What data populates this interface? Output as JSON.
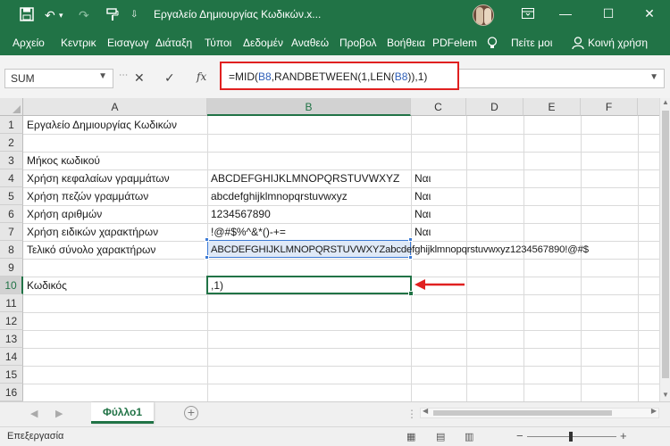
{
  "window": {
    "title": "Εργαλείο Δημιουργίας Κωδικών.x...",
    "accent": "#217346"
  },
  "ribbon": {
    "tabs": [
      "Αρχείο",
      "Κεντρικ",
      "Εισαγωγ",
      "Διάταξη",
      "Τύποι",
      "Δεδομέν",
      "Αναθεώ",
      "Προβολ",
      "Βοήθεια",
      "PDFelem",
      "Πείτε μοι",
      "Κοινή χρήση"
    ]
  },
  "formula_bar": {
    "name_box": "SUM",
    "formula_parts": [
      "=MID(",
      "B8",
      ",RANDBETWEEN(1,LEN(",
      "B8",
      ")),1)"
    ],
    "highlight_color": "#e02020"
  },
  "grid": {
    "columns": [
      "A",
      "B",
      "C",
      "D",
      "E",
      "F"
    ],
    "rows": [
      "1",
      "2",
      "3",
      "4",
      "5",
      "6",
      "7",
      "8",
      "9",
      "10",
      "11",
      "12",
      "13",
      "14",
      "15",
      "16"
    ],
    "cells": {
      "A1": "Εργαλείο Δημιουργίας Κωδικών",
      "A3": "Μήκος κωδικού",
      "A4": "Χρήση κεφαλαίων γραμμάτων",
      "B4": "ABCDEFGHIJKLMNOPQRSTUVWXYZ",
      "C4": "Ναι",
      "A5": "Χρήση πεζών γραμμάτων",
      "B5": "abcdefghijklmnopqrstuvwxyz",
      "C5": "Ναι",
      "A6": "Χρήση αριθμών",
      "B6": "1234567890",
      "C6": "Ναι",
      "A7": "Χρήση ειδικών χαρακτήρων",
      "B7": "!@#$%^&*()-+=",
      "C7": "Ναι",
      "A8": "Τελικό σύνολο χαρακτήρων",
      "B8": "ABCDEFGHIJKLMNOPQRSTUVWXYZabcdefghijklmnopqrstuvwxyz1234567890!@#$",
      "A10": "Κωδικός",
      "B10": ",1)"
    },
    "selected_column": "B",
    "selected_row": "10"
  },
  "sheets": {
    "tabs": [
      "Φύλλο1"
    ],
    "active": "Φύλλο1"
  },
  "status": {
    "mode": "Επεξεργασία"
  }
}
